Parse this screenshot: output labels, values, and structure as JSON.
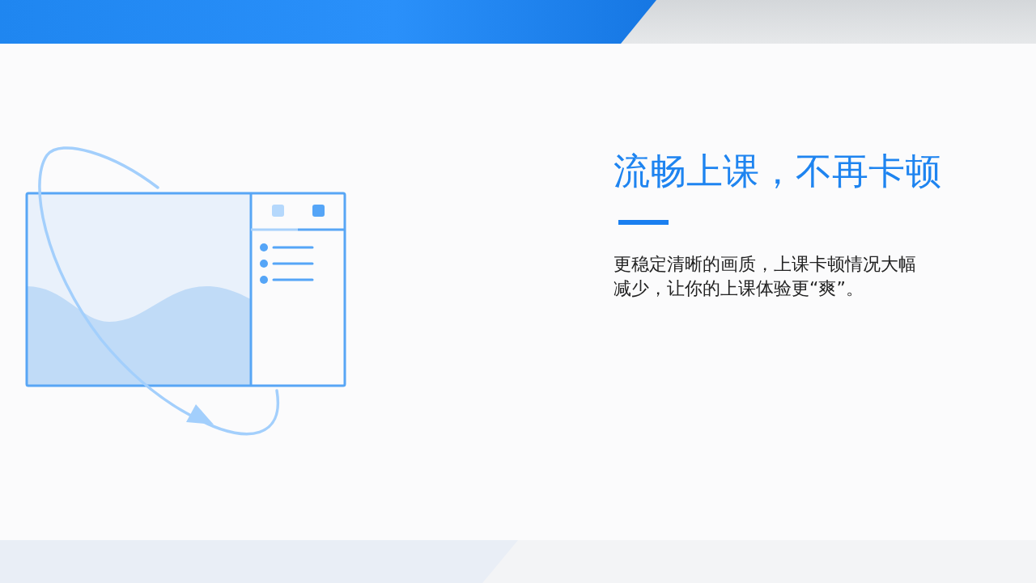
{
  "feature": {
    "title": "流畅上课，不再卡顿",
    "description": "更稳定清晰的画质，上课卡顿情况大幅减少，让你的上课体验更“爽”。"
  }
}
